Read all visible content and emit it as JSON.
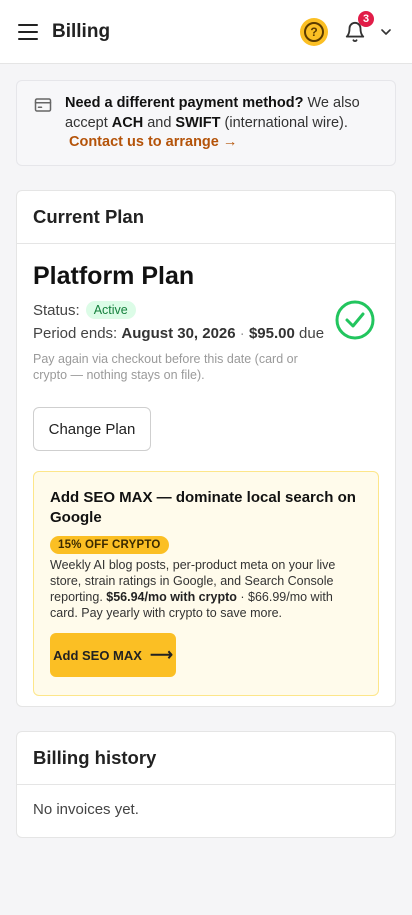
{
  "header": {
    "title": "Billing",
    "notification_count": "3",
    "help_glyph": "?"
  },
  "banner": {
    "lead": "Need a different payment method?",
    "t1": " We also accept ",
    "ach": "ACH",
    "t2": " and ",
    "swift": "SWIFT",
    "t3": " (international wire).",
    "link": "Contact us to arrange →"
  },
  "current_plan": {
    "header": "Current Plan",
    "name": "Platform Plan",
    "status_label": "Status:",
    "status": "Active",
    "period_label": "Period ends:",
    "period_date": "August 30, 2026",
    "separator": " · ",
    "amount": "$95.00",
    "due": "due",
    "note": "Pay again via checkout before this date (card or crypto — nothing stays on file).",
    "change_plan": "Change Plan"
  },
  "seo_upsell": {
    "title": "Add SEO MAX — dominate local search on Google",
    "badge": "15% OFF CRYPTO",
    "desc1": "Weekly AI blog posts, per-product meta on your live store, strain ratings in Google, and Search Console reporting. ",
    "crypto_price": "$56.94/mo with crypto",
    "desc2": " · $66.99/mo with card. Pay yearly with crypto to save more.",
    "button": "Add SEO MAX",
    "button_arrow": "⟶"
  },
  "billing_history": {
    "header": "Billing history",
    "empty": "No invoices yet."
  },
  "colors": {
    "accent": "#fbbf24",
    "link": "#b45309",
    "success": "#22c55e",
    "badge": "#e11d48"
  },
  "icons": [
    "menu-icon",
    "help-icon",
    "bell-icon",
    "chevron-down-icon",
    "credit-card-icon",
    "check-circle-icon",
    "arrow-right-icon"
  ]
}
